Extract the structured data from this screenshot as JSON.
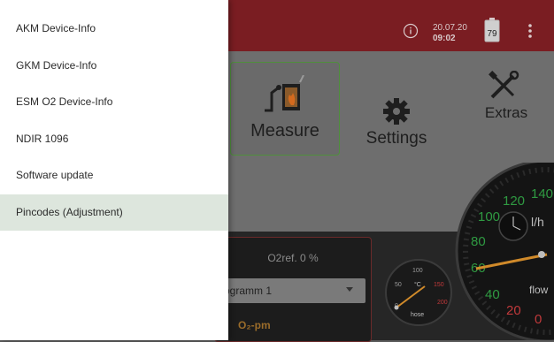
{
  "status": {
    "date": "20.07.20",
    "time": "09:02",
    "battery": "79"
  },
  "tiles": {
    "measure": "Measure",
    "settings": "Settings",
    "extras": "Extras"
  },
  "panel": {
    "o2ref": "O2ref. 0 %",
    "program_value": "ogramm 1",
    "mode": "O₂-pm"
  },
  "gauges": {
    "hose": {
      "unit": "°C",
      "caption": "hose",
      "ticks": [
        "50",
        "100",
        "150",
        "200",
        "0"
      ]
    },
    "flow": {
      "unit": "l/h",
      "caption": "flow",
      "ticks": [
        "140",
        "120",
        "100",
        "80",
        "60",
        "40",
        "20",
        "0"
      ]
    }
  },
  "drawer": {
    "items": [
      {
        "label": "AKM Device-Info"
      },
      {
        "label": "GKM Device-Info"
      },
      {
        "label": "ESM O2 Device-Info"
      },
      {
        "label": "NDIR 1096"
      },
      {
        "label": "Software update"
      },
      {
        "label": "Pincodes (Adjustment)"
      }
    ]
  },
  "colors": {
    "topbar": "#7a1d22",
    "drawer_active": "#dde6dd",
    "measure_border": "#4f8e3c"
  }
}
